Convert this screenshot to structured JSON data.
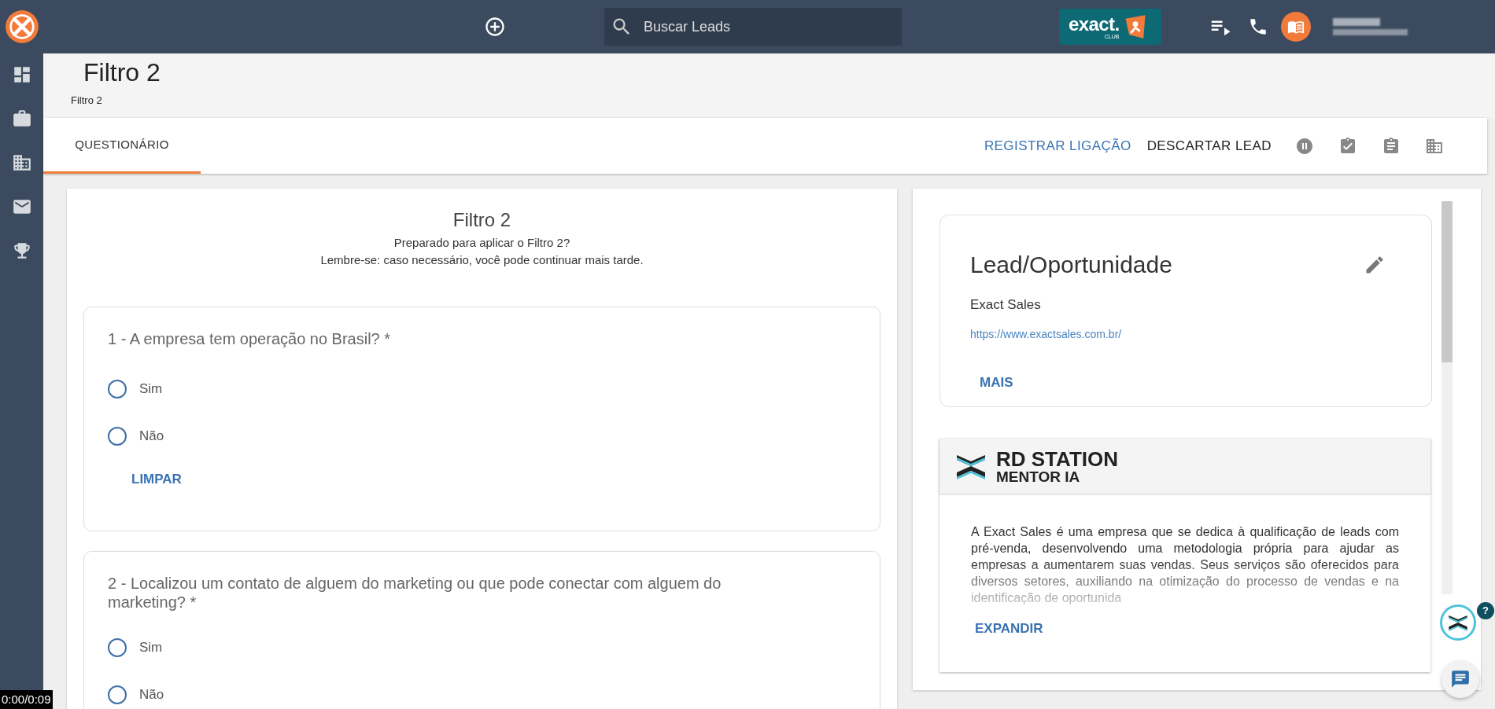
{
  "top_bar": {
    "search": {
      "placeholder": "Buscar Leads"
    },
    "brand_logo": {
      "word": "exact.",
      "tag": "CLUB"
    }
  },
  "sidebar": {
    "items": [
      {
        "kind": "dashboard",
        "selected": false
      },
      {
        "kind": "briefcase",
        "selected": false
      },
      {
        "kind": "building",
        "selected": false
      },
      {
        "kind": "mail",
        "selected": false
      },
      {
        "kind": "trophy",
        "selected": false
      }
    ]
  },
  "page_header": {
    "title": "Filtro 2",
    "breadcrumb": "Filtro 2"
  },
  "tabs": [
    {
      "label": "QUESTIONÁRIO",
      "selected": true
    }
  ],
  "actions": [
    {
      "kind": "link",
      "label": "REGISTRAR LIGAÇÃO"
    },
    {
      "kind": "text",
      "label": "DESCARTAR LEAD"
    },
    {
      "kind": "pause"
    },
    {
      "kind": "clipboard-check"
    },
    {
      "kind": "clipboard"
    },
    {
      "kind": "building"
    }
  ],
  "questionnaire": {
    "title": "Filtro 2",
    "intro": [
      "Preparado para aplicar o Filtro 2?",
      "Lembre-se: caso necessário, você pode continuar mais tarde."
    ],
    "questions": [
      {
        "text": "1 - A empresa tem operação no Brasil? *",
        "options": [
          {
            "label": "Sim",
            "selected": false
          },
          {
            "label": "Não",
            "selected": false
          }
        ],
        "clear": "LIMPAR"
      },
      {
        "text": "2 - Localizou um contato de alguem do marketing ou que pode conectar com alguem do marketing? *",
        "options": [
          {
            "label": "Sim",
            "selected": false
          },
          {
            "label": "Não",
            "selected": false
          }
        ]
      }
    ]
  },
  "lead_card": {
    "title": "Lead/Oportunidade",
    "company": "Exact Sales",
    "url": "https://www.exactsales.com.br/",
    "more": "MAIS"
  },
  "mentor_card": {
    "logo_line_1": "RD STATION",
    "logo_line_2": "MENTOR IA",
    "summary": "A Exact Sales é uma empresa que se dedica à qualificação de leads com pré-venda, desenvolvendo uma metodologia própria para ajudar as empresas a aumentarem suas vendas. Seus serviços são oferecidos para diversos setores, auxiliando na otimização do processo de vendas e na identificação de oportunida",
    "expand": "EXPANDIR"
  },
  "help_badge": "?",
  "video_time": "0:00/0:09"
}
